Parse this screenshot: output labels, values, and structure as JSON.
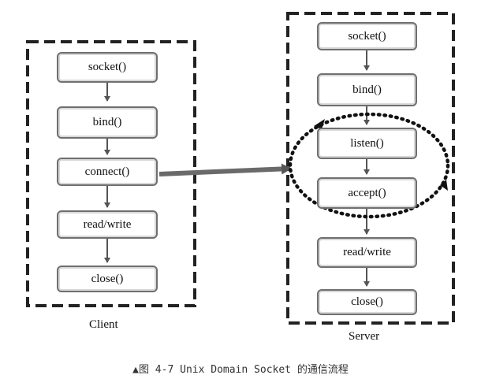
{
  "client": {
    "label": "Client",
    "steps": [
      "socket()",
      "bind()",
      "connect()",
      "read/write",
      "close()"
    ]
  },
  "server": {
    "label": "Server",
    "steps": [
      "socket()",
      "bind()",
      "listen()",
      "accept()",
      "read/write",
      "close()"
    ]
  },
  "caption": "▲图 4-7   Unix Domain Socket 的通信流程"
}
